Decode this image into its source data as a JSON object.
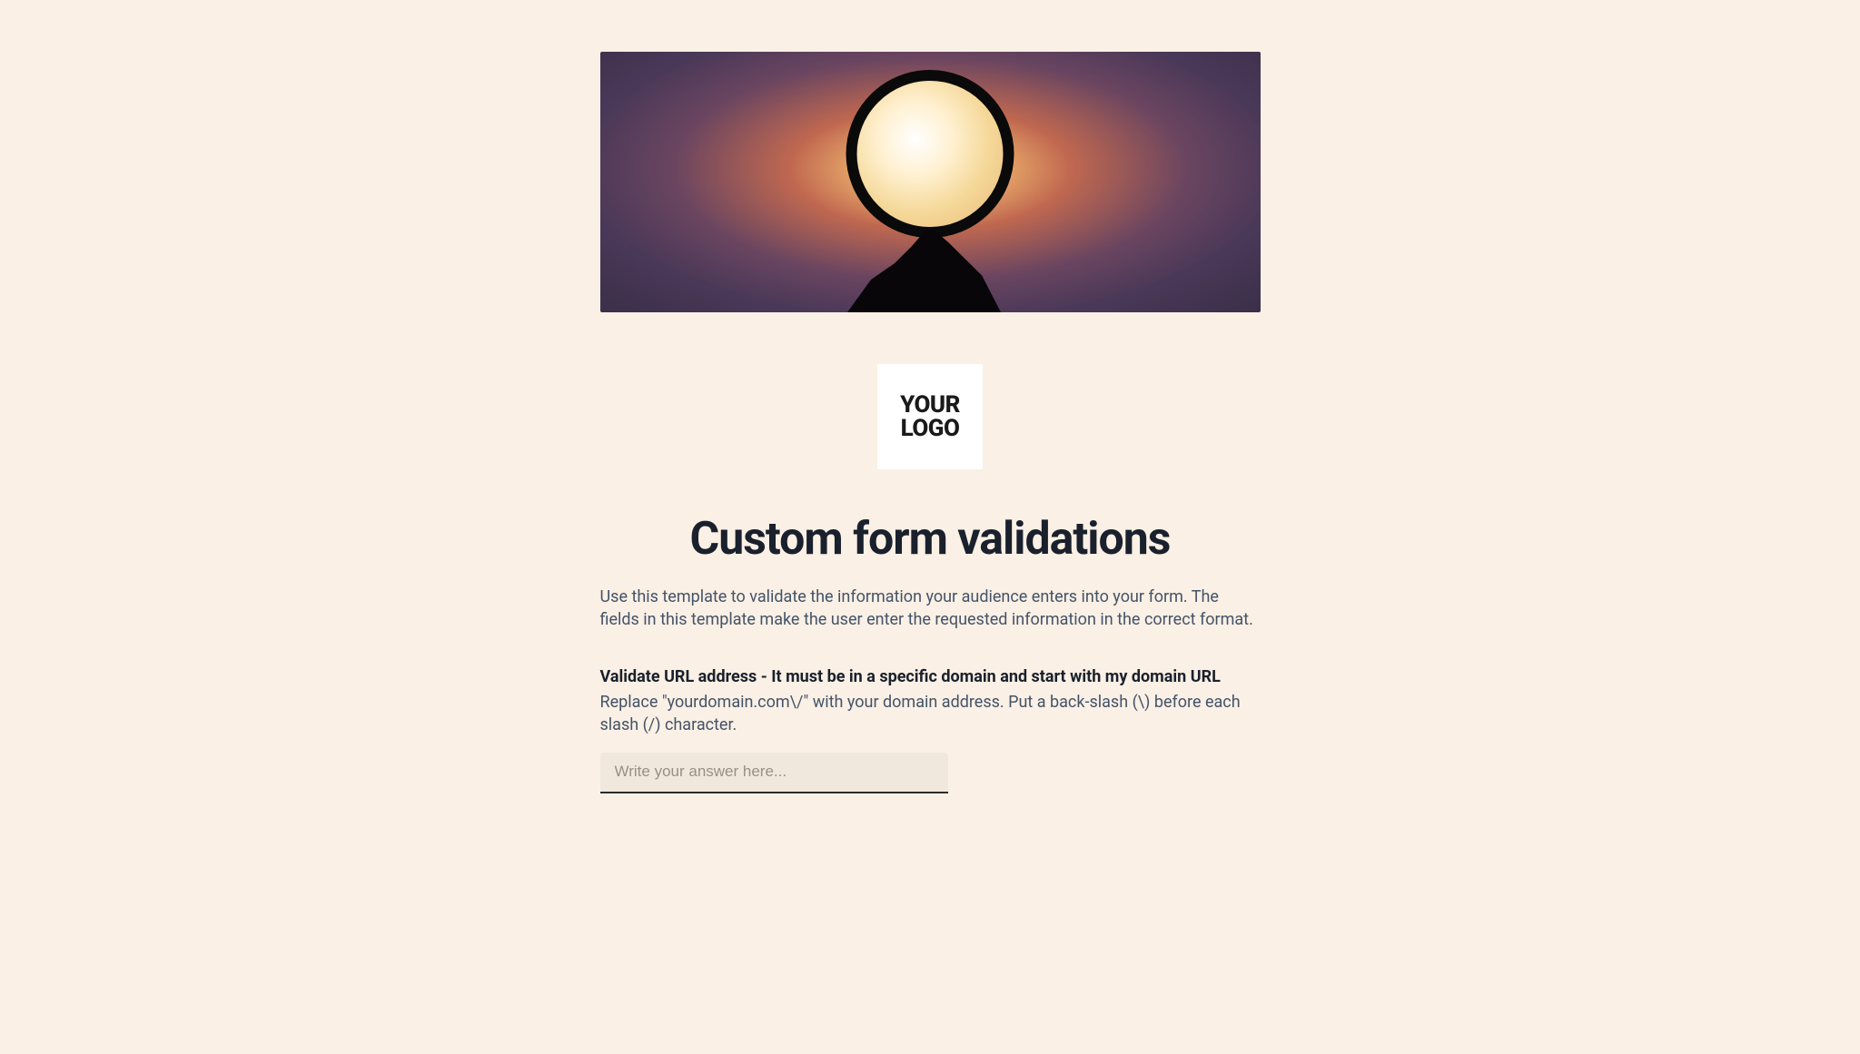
{
  "logo": {
    "line1": "YOUR",
    "line2": "LOGO"
  },
  "form": {
    "title": "Custom form validations",
    "description": "Use this template to validate the information your audience enters into your form. The fields in this template make the user enter the requested information in the correct format.",
    "field": {
      "label": "Validate URL address - It must be in a specific domain and start with my domain URL",
      "help": "Replace \"yourdomain.com\\/\" with your domain address. Put a back-slash (\\) before each slash (/) character.",
      "placeholder": "Write your answer here..."
    }
  }
}
